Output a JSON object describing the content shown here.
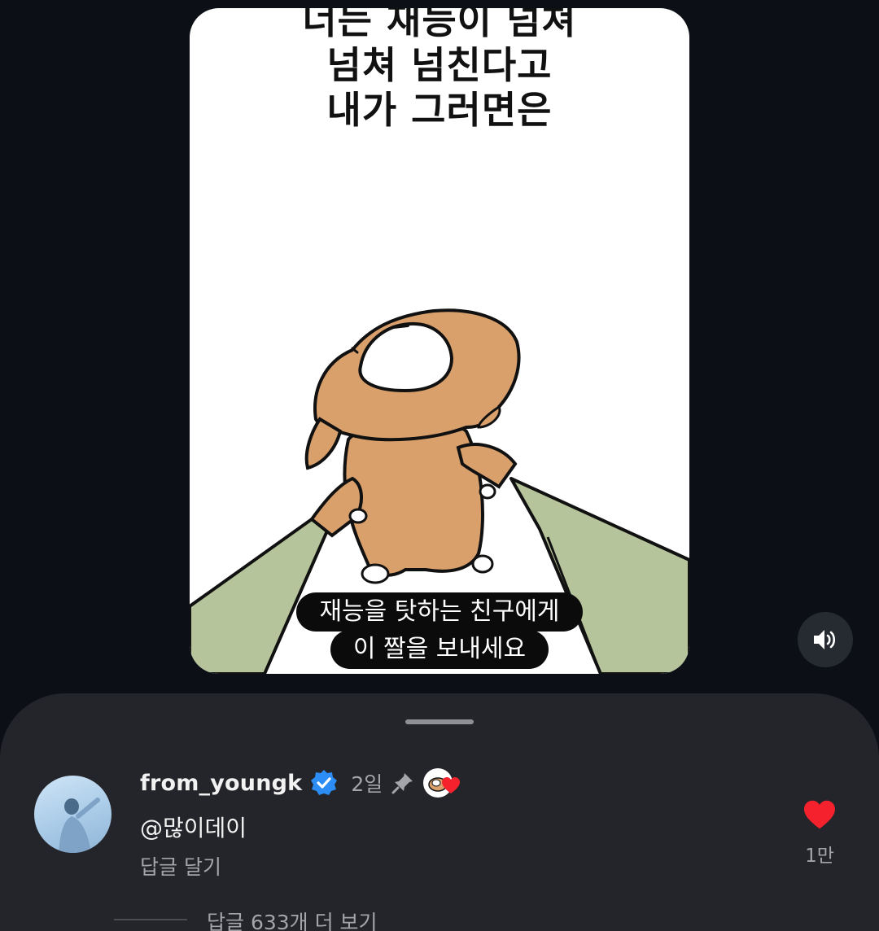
{
  "video": {
    "caption_lines": [
      "너는 재능이 넘쳐",
      "넘쳐 넘친다고",
      "내가 그러면은"
    ],
    "subtitle_lines": [
      "재능을 탓하는 친구에게",
      "이 짤을 보내세요"
    ]
  },
  "volume": {
    "icon": "speaker-icon"
  },
  "comment": {
    "username": "from_youngk",
    "verified_icon": "verified-badge-icon",
    "time_ago": "2일",
    "pin_icon": "pin-icon",
    "body": "@많이데이",
    "reply_label": "답글 달기",
    "like_count": "1만",
    "like_color": "#f5222d",
    "more_replies_label": "답글 633개 더 보기"
  }
}
